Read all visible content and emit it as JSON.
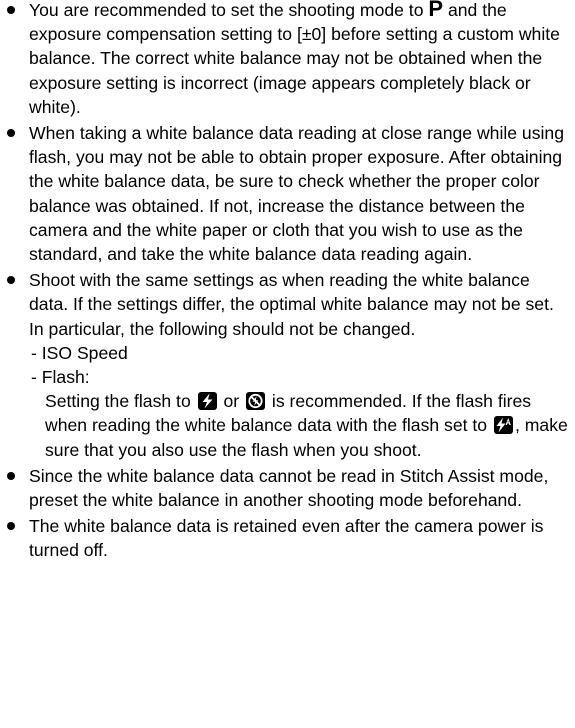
{
  "content": {
    "bullet1": {
      "text_before_mode": "You are recommended to set the shooting mode to ",
      "mode_glyph": "P",
      "text_after_mode": " and the exposure compensation setting to [±0] before setting a custom white balance. The correct white balance may not be obtained when the exposure setting is incorrect (image appears completely black or white)."
    },
    "bullet2": {
      "text": "When taking a white balance data reading at close range while using flash, you may not be able to obtain proper exposure. After obtaining the white balance data, be sure to check whether the proper color balance was obtained. If not, increase the distance between the camera and the white paper or cloth that you wish to use as the standard, and take the white balance data reading again."
    },
    "bullet3": {
      "text": "Shoot with the same settings as when reading the white balance data. If the settings differ, the optimal white balance may not be set. In particular, the following should not be changed.",
      "sub_item_iso": "- ISO Speed",
      "sub_item_flash": "- Flash:",
      "flash_note_part1": "Setting the flash to ",
      "flash_note_or": " or ",
      "flash_note_part2": " is recommended. If the flash fires when reading the white balance data with the flash set to ",
      "flash_note_part3": ", make sure that you also use the flash when you shoot.",
      "icons": {
        "flash_on": "flash-on-icon",
        "flash_off": "flash-off-icon",
        "flash_auto": "flash-auto-icon"
      }
    },
    "bullet4": {
      "text": "Since the white balance data cannot be read in Stitch Assist mode, preset the white balance in another shooting mode beforehand."
    },
    "bullet5": {
      "text": "The white balance data is retained even after the camera power is turned off."
    }
  }
}
